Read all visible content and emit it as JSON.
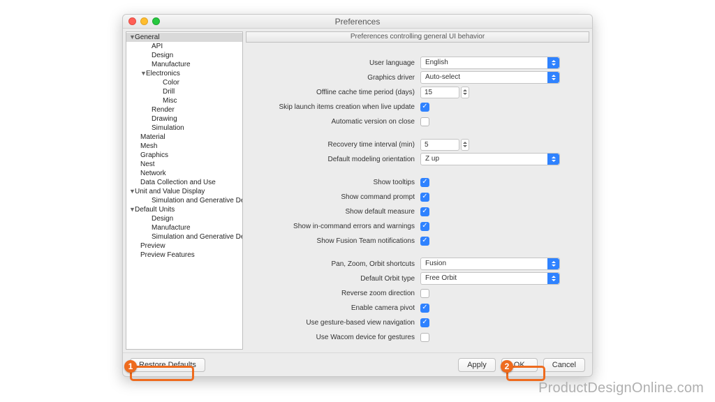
{
  "window": {
    "title": "Preferences"
  },
  "section_header": "Preferences controlling general UI behavior",
  "sidebar": {
    "items": [
      {
        "label": "General",
        "indent": 0,
        "expanded": true,
        "selected": true
      },
      {
        "label": "API",
        "indent": 1
      },
      {
        "label": "Design",
        "indent": 1
      },
      {
        "label": "Manufacture",
        "indent": 1
      },
      {
        "label": "Electronics",
        "indent": 1,
        "expanded": true
      },
      {
        "label": "Color",
        "indent": 2
      },
      {
        "label": "Drill",
        "indent": 2
      },
      {
        "label": "Misc",
        "indent": 2
      },
      {
        "label": "Render",
        "indent": 1
      },
      {
        "label": "Drawing",
        "indent": 1
      },
      {
        "label": "Simulation",
        "indent": 1
      },
      {
        "label": "Material",
        "indent": 0
      },
      {
        "label": "Mesh",
        "indent": 0
      },
      {
        "label": "Graphics",
        "indent": 0
      },
      {
        "label": "Nest",
        "indent": 0
      },
      {
        "label": "Network",
        "indent": 0
      },
      {
        "label": "Data Collection and Use",
        "indent": 0
      },
      {
        "label": "Unit and Value Display",
        "indent": 0,
        "expanded": true
      },
      {
        "label": "Simulation and Generative Desi…",
        "indent": 1
      },
      {
        "label": "Default Units",
        "indent": 0,
        "expanded": true
      },
      {
        "label": "Design",
        "indent": 1
      },
      {
        "label": "Manufacture",
        "indent": 1
      },
      {
        "label": "Simulation and Generative Desi…",
        "indent": 1
      },
      {
        "label": "Preview",
        "indent": 0
      },
      {
        "label": "Preview Features",
        "indent": 0
      }
    ]
  },
  "form": {
    "user_language": {
      "label": "User language",
      "value": "English"
    },
    "graphics_driver": {
      "label": "Graphics driver",
      "value": "Auto-select"
    },
    "offline_cache": {
      "label": "Offline cache time period (days)",
      "value": "15"
    },
    "skip_launch": {
      "label": "Skip launch items creation when live update",
      "checked": true
    },
    "auto_version": {
      "label": "Automatic version on close",
      "checked": false
    },
    "recovery_interval": {
      "label": "Recovery time interval (min)",
      "value": "5"
    },
    "modeling_orient": {
      "label": "Default modeling orientation",
      "value": "Z up"
    },
    "tooltips": {
      "label": "Show tooltips",
      "checked": true
    },
    "cmd_prompt": {
      "label": "Show command prompt",
      "checked": true
    },
    "default_measure": {
      "label": "Show default measure",
      "checked": true
    },
    "incmd_errors": {
      "label": "Show in-command errors and warnings",
      "checked": true
    },
    "team_notif": {
      "label": "Show Fusion Team notifications",
      "checked": true
    },
    "pan_zoom": {
      "label": "Pan, Zoom, Orbit shortcuts",
      "value": "Fusion"
    },
    "orbit_type": {
      "label": "Default Orbit type",
      "value": "Free Orbit"
    },
    "reverse_zoom": {
      "label": "Reverse zoom direction",
      "checked": false
    },
    "camera_pivot": {
      "label": "Enable camera pivot",
      "checked": true
    },
    "gesture_nav": {
      "label": "Use gesture-based view navigation",
      "checked": true
    },
    "wacom": {
      "label": "Use Wacom device for gestures",
      "checked": false
    }
  },
  "footer": {
    "restore": "Restore Defaults",
    "apply": "Apply",
    "ok": "OK",
    "cancel": "Cancel"
  },
  "callouts": {
    "one": "1",
    "two": "2"
  },
  "watermark": "ProductDesignOnline.com"
}
